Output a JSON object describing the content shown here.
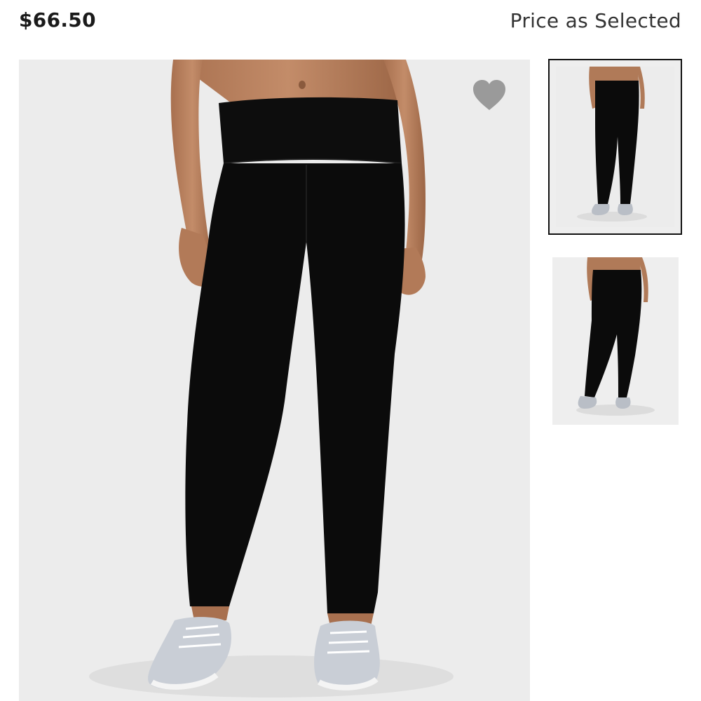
{
  "product": {
    "price": "$66.50",
    "price_note": "Price as Selected"
  },
  "gallery": {
    "main_image_subject": "model wearing black full-length leggings and grey running sneakers, front view",
    "thumbnails": [
      {
        "subject": "front view",
        "selected": true
      },
      {
        "subject": "back view",
        "selected": false
      }
    ]
  },
  "icons": {
    "wishlist": "heart-icon"
  },
  "colors": {
    "background": "#ffffff",
    "image_bg": "#ececec",
    "heart": "#9a9a9a",
    "selected_border": "#111111",
    "leggings": "#0c0c0c",
    "skin": "#b57f5e"
  }
}
